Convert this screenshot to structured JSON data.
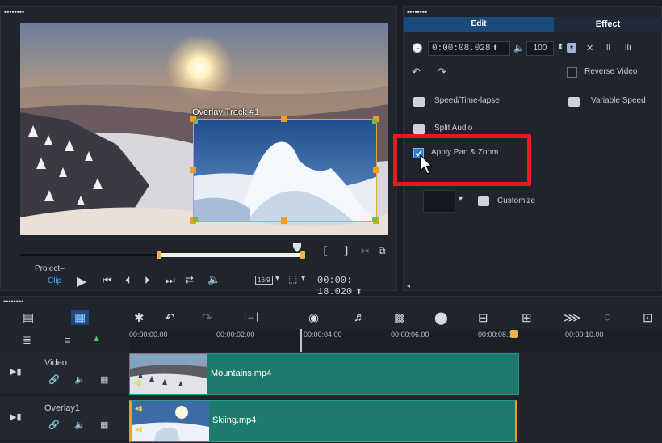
{
  "preview": {
    "overlay_label": "Overlay Track #1",
    "project_label": "Project",
    "clip_label": "Clip",
    "aspect_label": "16:9",
    "timecode": "00:00: 18.020",
    "mark_in": "[",
    "mark_out": "]"
  },
  "options": {
    "tab_edit": "Edit",
    "tab_effect": "Effect",
    "duration": "0:00:08.028",
    "volume": "100",
    "reverse_video": "Reverse Video",
    "speed_timelapse": "Speed/Time-lapse",
    "variable_speed": "Variable Speed",
    "split_audio": "Split Audio",
    "apply_pan_zoom": "Apply Pan & Zoom",
    "apply_pan_zoom_checked": true,
    "customize": "Customize"
  },
  "timeline": {
    "ruler_ticks": [
      "00:00:00.00",
      "00:00:02.00",
      "00:00:04.00",
      "00:00:06.00",
      "00:00:08.00",
      "00:00:10.00"
    ],
    "tracks": [
      {
        "name": "Video",
        "clip": "Mountains.mp4"
      },
      {
        "name": "Overlay1",
        "clip": "Skiing.mp4"
      }
    ]
  },
  "colors": {
    "accent_blue": "#1b4a7c",
    "clip_teal": "#1e7a6b",
    "handle_orange": "#f29d1c",
    "highlight_red": "#e31b23"
  }
}
